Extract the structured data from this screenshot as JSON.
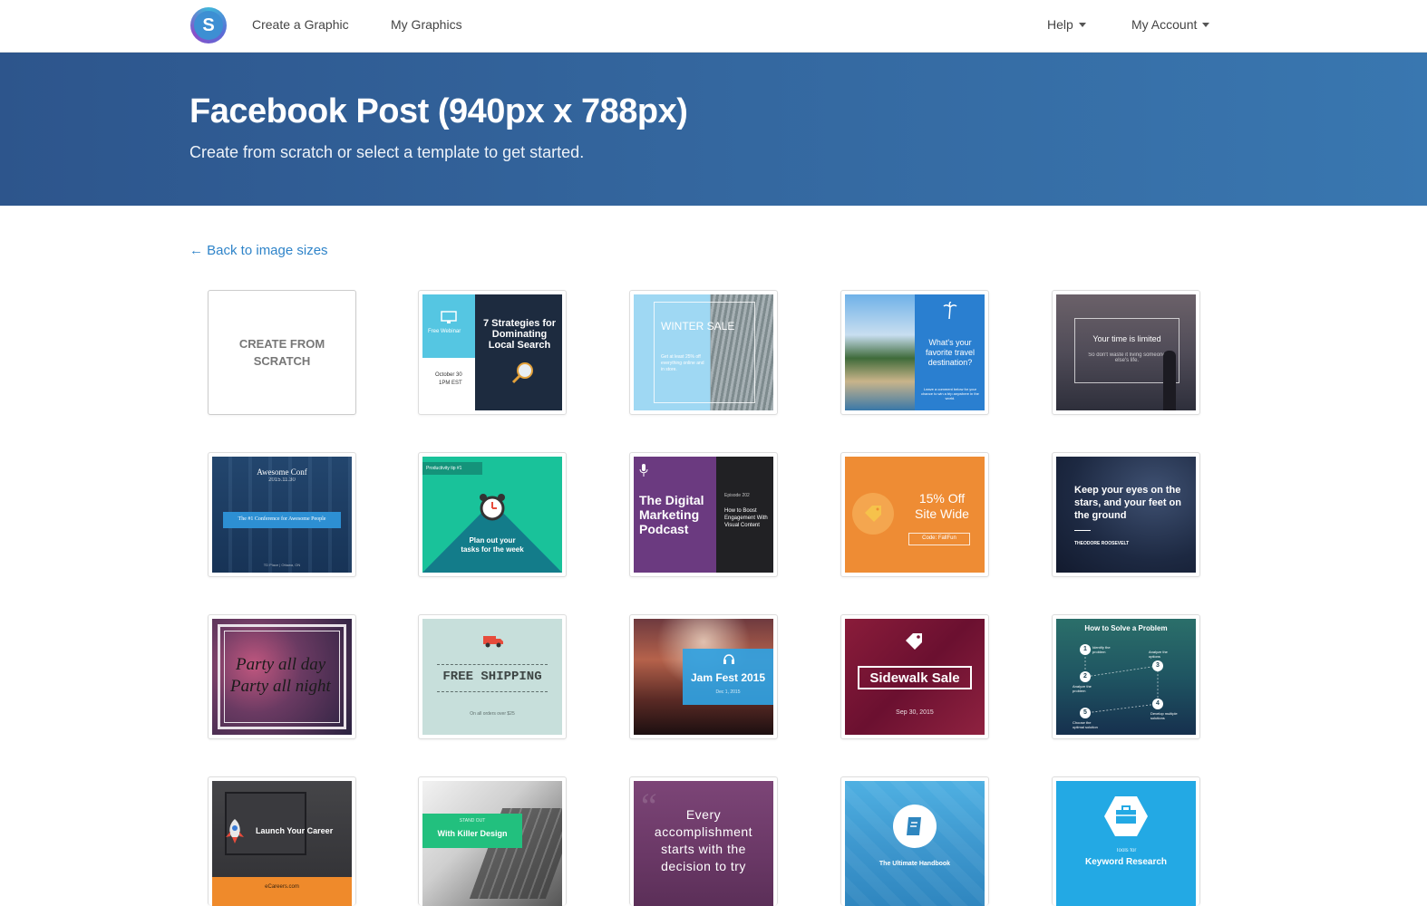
{
  "nav": {
    "logo_letter": "S",
    "create_label": "Create a Graphic",
    "mygraphics_label": "My Graphics",
    "help_label": "Help",
    "account_label": "My Account"
  },
  "hero": {
    "title": "Facebook Post (940px x 788px)",
    "subtitle": "Create from scratch or select a template to get started."
  },
  "back_link": "← Back to image sizes",
  "scratch": {
    "line1": "CREATE FROM",
    "line2": "SCRATCH"
  },
  "templates": {
    "t1": {
      "badge": "Free Webinar",
      "title": "7 Strategies for Dominating Local Search",
      "date": "October 30",
      "time": "1PM EST"
    },
    "t2": {
      "title": "WINTER SALE",
      "body": "Get at least 25% off everything online and in store."
    },
    "t3": {
      "title": "What's your favorite travel destination?",
      "body": "Leave a comment below for your chance to win a trip anywhere in the world."
    },
    "t4": {
      "title": "Your time is limited",
      "body": "So don't waste it living someone else's life."
    },
    "t5": {
      "title": "Awesome Conf",
      "date": "2015.11.30",
      "banner": "The #1 Conference for Awesome People",
      "place": "TD Place | Ottawa, ON"
    },
    "t6": {
      "badge": "Productivity tip #1",
      "title": "Plan out your tasks for the week"
    },
    "t7": {
      "title": "The Digital Marketing Podcast",
      "episode": "Episode 202",
      "body": "How to Boost Engagement With Visual Content"
    },
    "t8": {
      "title": "15% Off Site Wide",
      "code": "Code: FallFun"
    },
    "t9": {
      "title": "Keep your eyes on the stars, and your feet on the ground",
      "author": "THEODORE ROOSEVELT"
    },
    "t10": {
      "line1": "Party all day",
      "line2": "Party all night"
    },
    "t11": {
      "title": "FREE SHIPPING",
      "body": "On all orders over $25"
    },
    "t12": {
      "title": "Jam Fest 2015",
      "date": "Dec 1, 2015"
    },
    "t13": {
      "title": "Sidewalk Sale",
      "date": "Sep 30, 2015"
    },
    "t14": {
      "title": "How to Solve a Problem",
      "step1": "Identify the problem",
      "step2": "Analyze the problem",
      "step3": "Analyze the options",
      "step4": "Develop multiple solutions",
      "step5": "Choose the optimal solution",
      "n1": "1",
      "n2": "2",
      "n3": "3",
      "n4": "4",
      "n5": "5"
    },
    "t15": {
      "title": "Launch Your Career",
      "brand": "eCareers.com"
    },
    "t16": {
      "kicker": "STAND OUT",
      "title": "With Killer Design"
    },
    "t17": {
      "title": "Every accomplishment starts with the decision to try"
    },
    "t18": {
      "title": "The Ultimate Handbook"
    },
    "t19": {
      "kicker": "Tools for",
      "title": "Keyword Research"
    }
  },
  "colors": {
    "hero_start": "#2d558c",
    "hero_end": "#3977b0",
    "link": "#2f84c9"
  },
  "icons": [
    "monitor-icon",
    "magnifier-icon",
    "tag-icon",
    "palm-tree-icon",
    "alarm-clock-icon",
    "microphone-icon",
    "truck-icon",
    "headphones-icon",
    "rocket-icon",
    "book-icon",
    "toolbox-icon"
  ]
}
